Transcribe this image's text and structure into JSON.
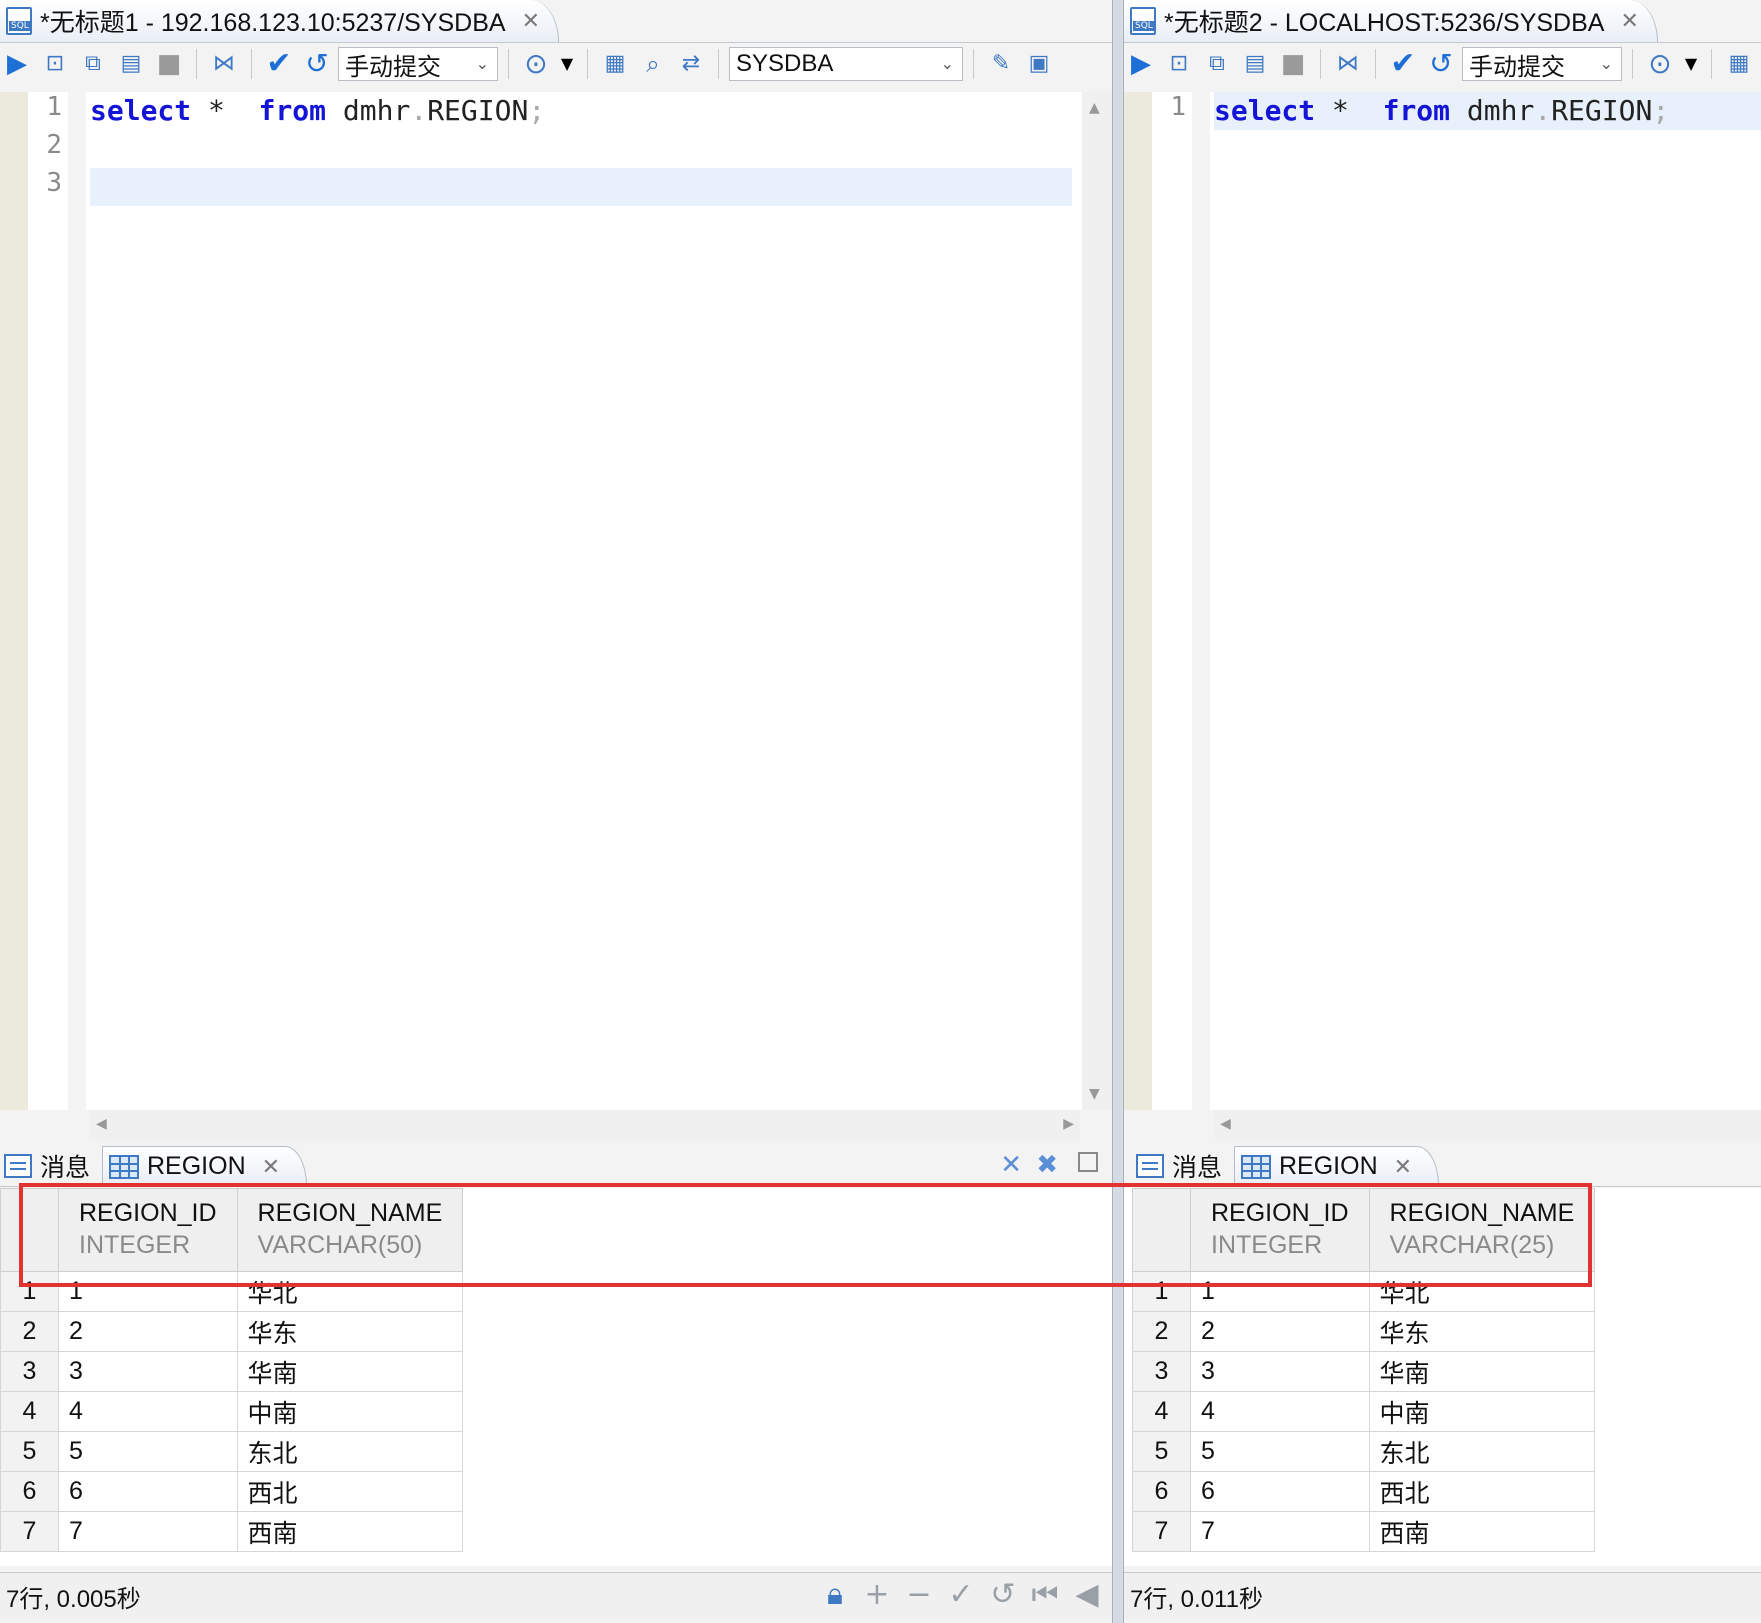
{
  "left": {
    "tab_title": "*无标题1 - 192.168.123.10:5237/SYSDBA",
    "commit_mode": "手动提交",
    "schema": "SYSDBA",
    "lines": [
      "1",
      "2",
      "3"
    ],
    "sql": {
      "kw1": "select",
      "star": "*",
      "kw2": "from",
      "schema": "dmhr",
      "dot": ".",
      "table": "REGION",
      "semi": ";"
    },
    "result_tabs": {
      "messages": "消息",
      "region": "REGION"
    },
    "columns": [
      {
        "name": "REGION_ID",
        "type": "INTEGER"
      },
      {
        "name": "REGION_NAME",
        "type": "VARCHAR(50)"
      }
    ],
    "rows": [
      {
        "n": "1",
        "id": "1",
        "name": "华北"
      },
      {
        "n": "2",
        "id": "2",
        "name": "华东"
      },
      {
        "n": "3",
        "id": "3",
        "name": "华南"
      },
      {
        "n": "4",
        "id": "4",
        "name": "中南"
      },
      {
        "n": "5",
        "id": "5",
        "name": "东北"
      },
      {
        "n": "6",
        "id": "6",
        "name": "西北"
      },
      {
        "n": "7",
        "id": "7",
        "name": "西南"
      }
    ],
    "status": "7行, 0.005秒"
  },
  "right": {
    "tab_title": "*无标题2 - LOCALHOST:5236/SYSDBA",
    "commit_mode": "手动提交",
    "lines": [
      "1"
    ],
    "sql": {
      "kw1": "select",
      "star": "*",
      "kw2": "from",
      "schema": "dmhr",
      "dot": ".",
      "table": "REGION",
      "semi": ";"
    },
    "result_tabs": {
      "messages": "消息",
      "region": "REGION"
    },
    "columns": [
      {
        "name": "REGION_ID",
        "type": "INTEGER"
      },
      {
        "name": "REGION_NAME",
        "type": "VARCHAR(25)"
      }
    ],
    "rows": [
      {
        "n": "1",
        "id": "1",
        "name": "华北"
      },
      {
        "n": "2",
        "id": "2",
        "name": "华东"
      },
      {
        "n": "3",
        "id": "3",
        "name": "华南"
      },
      {
        "n": "4",
        "id": "4",
        "name": "中南"
      },
      {
        "n": "5",
        "id": "5",
        "name": "东北"
      },
      {
        "n": "6",
        "id": "6",
        "name": "西北"
      },
      {
        "n": "7",
        "id": "7",
        "name": "西南"
      }
    ],
    "status": "7行, 0.011秒"
  },
  "colors": {
    "keyword": "#1414d6",
    "accent": "#3f79c4",
    "highlight": "#e23232",
    "run": "#1e6fd6",
    "check": "#1e6fd6"
  },
  "icons": [
    "run-icon",
    "run-line-icon",
    "explain-icon",
    "script-icon",
    "stop-icon",
    "filter-icon",
    "commit-icon",
    "rollback-icon",
    "target-icon",
    "query-plan-icon",
    "find-icon",
    "compare-icon",
    "format-icon",
    "layout-icon",
    "lock-icon",
    "add-row-icon",
    "remove-row-icon",
    "apply-icon",
    "revert-icon",
    "first-page-icon",
    "prev-page-icon"
  ]
}
